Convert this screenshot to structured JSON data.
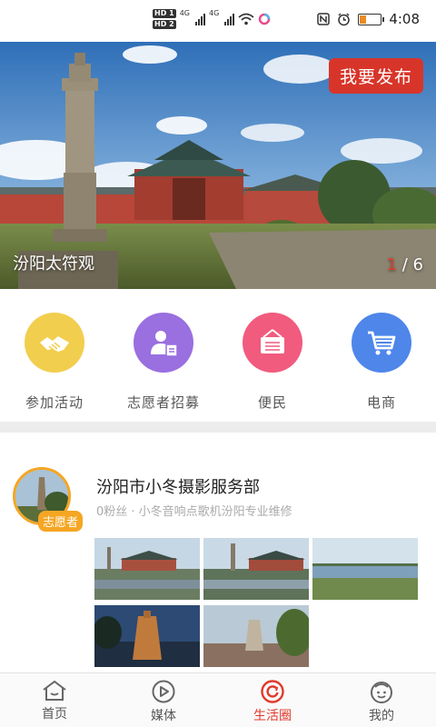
{
  "status_bar": {
    "hd1": "HD 1",
    "hd2": "HD 2",
    "sig1": "4G",
    "sig2": "4G",
    "time": "4:08"
  },
  "banner": {
    "caption": "汾阳太符观",
    "page_current": "1",
    "page_total": "/ 6",
    "publish_label": "我要发布"
  },
  "quick_menu": [
    {
      "label": "参加活动",
      "icon": "handshake-icon",
      "color": "#f2ce4e"
    },
    {
      "label": "志愿者招募",
      "icon": "volunteer-icon",
      "color": "#9a6fe0"
    },
    {
      "label": "便民",
      "icon": "shop-sign-icon",
      "color": "#f15b7e"
    },
    {
      "label": "电商",
      "icon": "cart-icon",
      "color": "#4e86ea"
    }
  ],
  "post": {
    "title": "汾阳市小冬摄影服务部",
    "meta": "0粉丝 · 小冬音响点歌机汾阳专业维修",
    "badge": "志愿者"
  },
  "tabbar": [
    {
      "label": "首页",
      "icon": "home-icon",
      "active": false
    },
    {
      "label": "媒体",
      "icon": "play-icon",
      "active": false
    },
    {
      "label": "生活圈",
      "icon": "life-circle-icon",
      "active": true
    },
    {
      "label": "我的",
      "icon": "profile-icon",
      "active": false
    }
  ],
  "colors": {
    "accent": "#e1392b",
    "badge": "#f5a623"
  }
}
